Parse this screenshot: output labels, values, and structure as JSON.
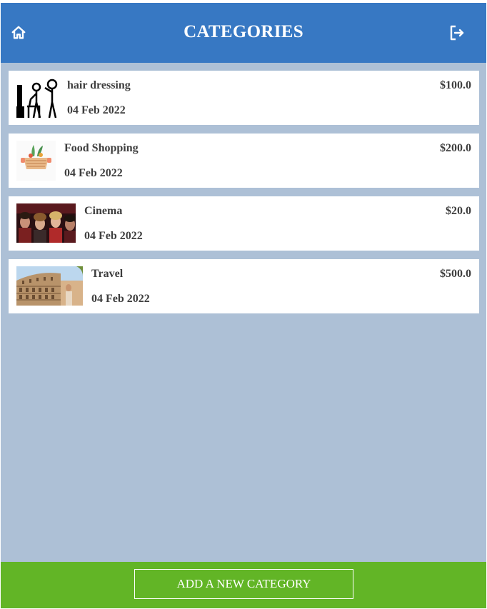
{
  "header": {
    "title": "CATEGORIES",
    "home_icon": "home-icon",
    "logout_icon": "logout-icon"
  },
  "categories": [
    {
      "name": "hair dressing",
      "date": "04 Feb 2022",
      "amount": "$100.0",
      "image": "hairdresser-pictogram"
    },
    {
      "name": "Food Shopping",
      "date": "04 Feb 2022",
      "amount": "$200.0",
      "image": "vegetable-basket"
    },
    {
      "name": "Cinema",
      "date": "04 Feb 2022",
      "amount": "$20.0",
      "image": "cinema-audience-photo"
    },
    {
      "name": "Travel",
      "date": "04 Feb 2022",
      "amount": "$500.0",
      "image": "colosseum-photo"
    }
  ],
  "footer": {
    "add_label": "ADD A NEW CATEGORY"
  },
  "colors": {
    "header": "#3778c3",
    "background": "#adc0d6",
    "footer": "#62b526",
    "text": "#3d3d3d"
  }
}
